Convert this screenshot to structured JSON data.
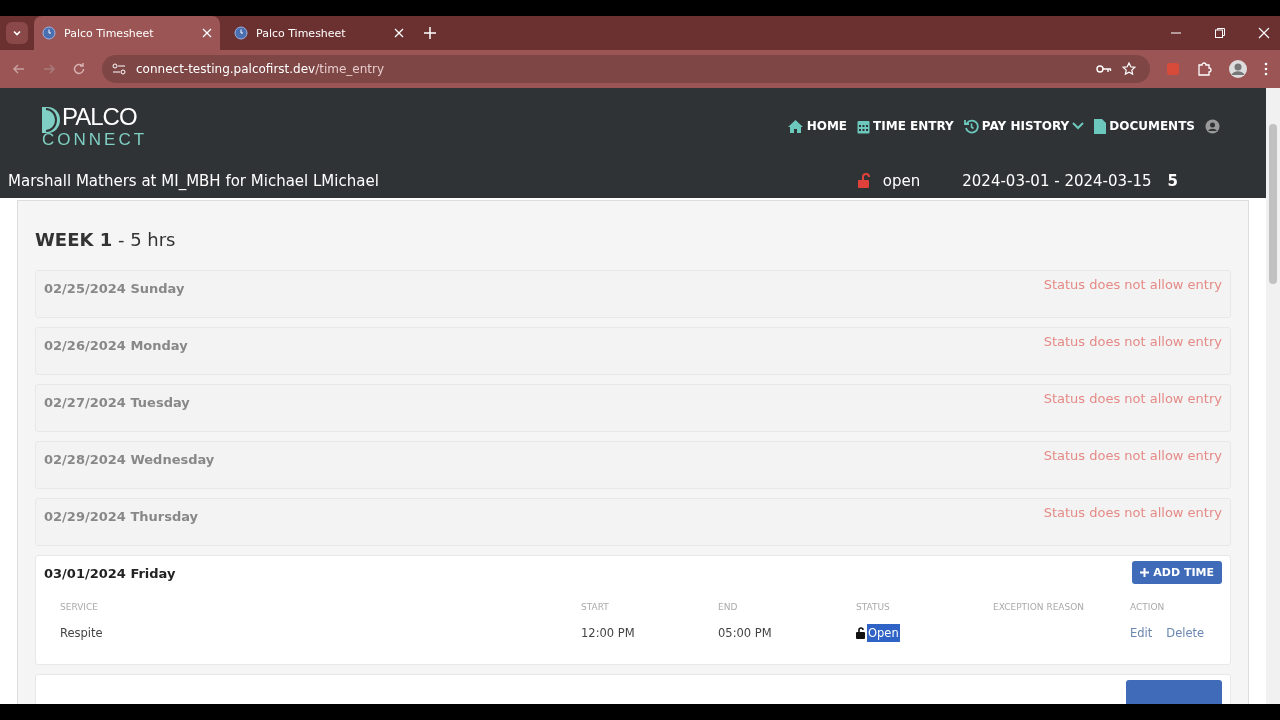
{
  "browser": {
    "tabs": [
      {
        "title": "Palco Timesheet",
        "selected": true
      },
      {
        "title": "Palco Timesheet",
        "selected": false
      }
    ],
    "url_host": "connect-testing.palcofirst.dev",
    "url_path": "/time_entry"
  },
  "nav": [
    {
      "label": "HOME",
      "kind": "home"
    },
    {
      "label": "TIME ENTRY",
      "kind": "calendar"
    },
    {
      "label": "PAY HISTORY",
      "kind": "history"
    },
    {
      "label": "DOCUMENTS",
      "kind": "document"
    }
  ],
  "logo": {
    "top": "PALCO",
    "bottom": "CONNECT"
  },
  "context": "Marshall Mathers at MI_MBH for Michael LMichael",
  "period": {
    "status": "open",
    "range": "2024-03-01 - 2024-03-15",
    "hours": "5"
  },
  "week": {
    "title": "WEEK 1",
    "hours": " - 5 hrs"
  },
  "days": [
    {
      "kind": "locked",
      "date": "02/25/2024 Sunday",
      "message": "Status does not allow entry"
    },
    {
      "kind": "locked",
      "date": "02/26/2024 Monday",
      "message": "Status does not allow entry"
    },
    {
      "kind": "locked",
      "date": "02/27/2024 Tuesday",
      "message": "Status does not allow entry"
    },
    {
      "kind": "locked",
      "date": "02/28/2024 Wednesday",
      "message": "Status does not allow entry"
    },
    {
      "kind": "locked",
      "date": "02/29/2024 Thursday",
      "message": "Status does not allow entry"
    },
    {
      "kind": "open",
      "date": "03/01/2024 Friday",
      "button": "ADD TIME",
      "columns": [
        "SERVICE",
        "START",
        "END",
        "STATUS",
        "EXCEPTION REASON",
        "ACTION"
      ],
      "rows": [
        {
          "service": "Respite",
          "start": "12:00 PM",
          "end": "05:00 PM",
          "status": "Open",
          "highlighted": true,
          "actions": [
            "Edit",
            "Delete"
          ]
        }
      ]
    }
  ]
}
